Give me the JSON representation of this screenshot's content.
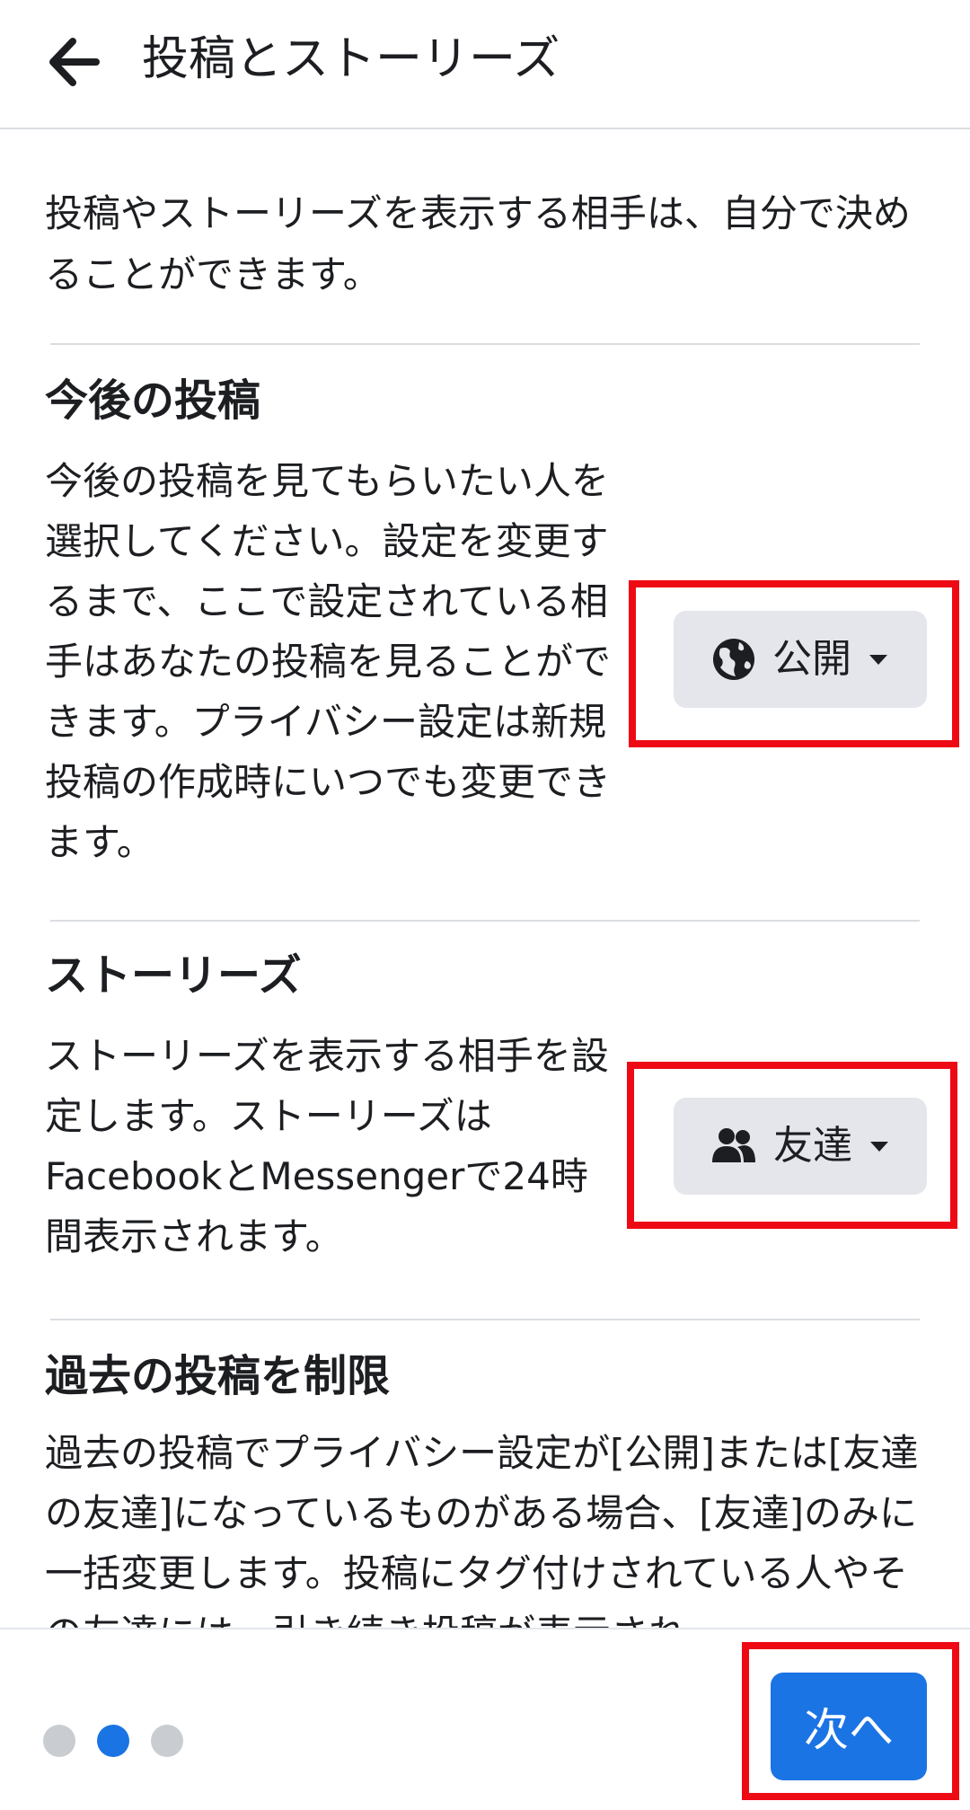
{
  "header": {
    "title": "投稿とストーリーズ",
    "back_icon": "arrow-left-icon"
  },
  "intro": "投稿やストーリーズを表示する相手は、自分で決めることができます。",
  "sections": {
    "future_posts": {
      "title": "今後の投稿",
      "description": "今後の投稿を見てもらいたい人を選択してください。設定を変更するまで、ここで設定されている相手はあなたの投稿を見ることができます。プライバシー設定は新規投稿の作成時にいつでも変更できます。",
      "audience": {
        "label": "公開",
        "icon": "globe-icon"
      }
    },
    "stories": {
      "title": "ストーリーズ",
      "description": "ストーリーズを表示する相手を設定します。ストーリーズはFacebookとMessengerで24時間表示されます。",
      "audience": {
        "label": "友達",
        "icon": "friends-icon"
      }
    },
    "limit_past": {
      "title": "過去の投稿を制限",
      "description": "過去の投稿でプライバシー設定が[公開]または[友達の友達]になっているものがある場合、[友達]のみに一括変更します。投稿にタグ付けされている人やその友達には、引き続き投稿が表示され"
    }
  },
  "footer": {
    "pagination": {
      "total": 3,
      "current": 2
    },
    "next_label": "次へ"
  },
  "colors": {
    "accent": "#1b74e4",
    "highlight": "#ee0a14",
    "dot_inactive": "#c9ccd1",
    "button_bg": "#e4e6eb"
  }
}
